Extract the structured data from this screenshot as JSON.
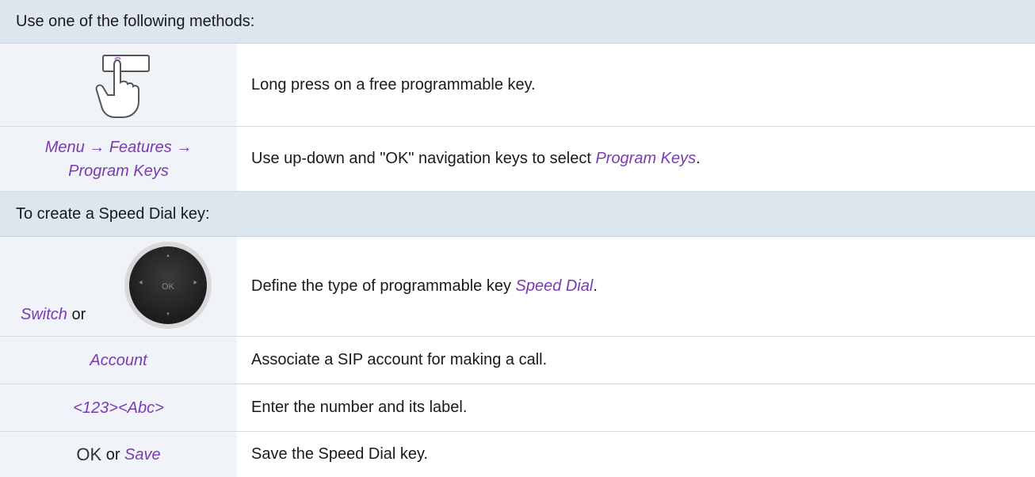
{
  "header1": "Use one of the following methods:",
  "row1": {
    "text": "Long press on a free programmable key.",
    "icon": "hand-press-key-icon"
  },
  "row2": {
    "left_line1": "Menu → Features →",
    "left_line2": "Program Keys",
    "text_before": "Use up-down and \"OK\" navigation keys to select ",
    "text_kw": "Program Keys",
    "text_after": "."
  },
  "header2": "To create a Speed Dial key:",
  "row3": {
    "left_kw": "Switch",
    "left_or": " or",
    "nav_ok": "OK",
    "nav_up": "▲",
    "nav_down": "▼",
    "nav_left": "◀",
    "nav_right": "▶",
    "text_before": "Define the type of programmable key ",
    "text_kw": "Speed Dial",
    "text_after": "."
  },
  "row4": {
    "left": "Account",
    "text": "Associate a SIP account for making a call."
  },
  "row5": {
    "left": "<123><Abc>",
    "text": "Enter the number and its label."
  },
  "row6": {
    "left_ok": "OK",
    "left_or": " or ",
    "left_kw": "Save",
    "text": "Save the Speed Dial key."
  },
  "colors": {
    "header_bg": "#dde5ef",
    "accent": "#7a3ab3",
    "row_alt": "#f0f3f8"
  }
}
